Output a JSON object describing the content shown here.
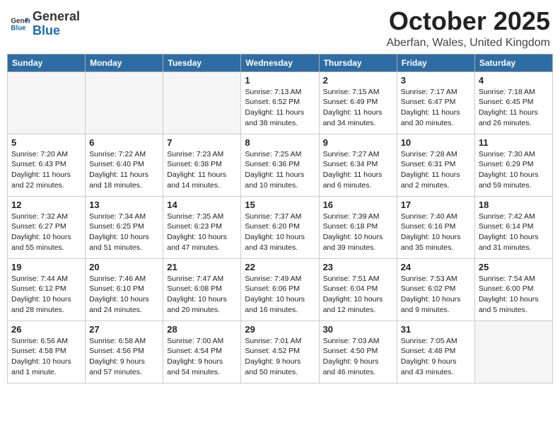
{
  "header": {
    "logo_general": "General",
    "logo_blue": "Blue",
    "month_title": "October 2025",
    "location": "Aberfan, Wales, United Kingdom"
  },
  "weekdays": [
    "Sunday",
    "Monday",
    "Tuesday",
    "Wednesday",
    "Thursday",
    "Friday",
    "Saturday"
  ],
  "weeks": [
    [
      {
        "day": "",
        "text": ""
      },
      {
        "day": "",
        "text": ""
      },
      {
        "day": "",
        "text": ""
      },
      {
        "day": "1",
        "text": "Sunrise: 7:13 AM\nSunset: 6:52 PM\nDaylight: 11 hours\nand 38 minutes."
      },
      {
        "day": "2",
        "text": "Sunrise: 7:15 AM\nSunset: 6:49 PM\nDaylight: 11 hours\nand 34 minutes."
      },
      {
        "day": "3",
        "text": "Sunrise: 7:17 AM\nSunset: 6:47 PM\nDaylight: 11 hours\nand 30 minutes."
      },
      {
        "day": "4",
        "text": "Sunrise: 7:18 AM\nSunset: 6:45 PM\nDaylight: 11 hours\nand 26 minutes."
      }
    ],
    [
      {
        "day": "5",
        "text": "Sunrise: 7:20 AM\nSunset: 6:43 PM\nDaylight: 11 hours\nand 22 minutes."
      },
      {
        "day": "6",
        "text": "Sunrise: 7:22 AM\nSunset: 6:40 PM\nDaylight: 11 hours\nand 18 minutes."
      },
      {
        "day": "7",
        "text": "Sunrise: 7:23 AM\nSunset: 6:38 PM\nDaylight: 11 hours\nand 14 minutes."
      },
      {
        "day": "8",
        "text": "Sunrise: 7:25 AM\nSunset: 6:36 PM\nDaylight: 11 hours\nand 10 minutes."
      },
      {
        "day": "9",
        "text": "Sunrise: 7:27 AM\nSunset: 6:34 PM\nDaylight: 11 hours\nand 6 minutes."
      },
      {
        "day": "10",
        "text": "Sunrise: 7:28 AM\nSunset: 6:31 PM\nDaylight: 11 hours\nand 2 minutes."
      },
      {
        "day": "11",
        "text": "Sunrise: 7:30 AM\nSunset: 6:29 PM\nDaylight: 10 hours\nand 59 minutes."
      }
    ],
    [
      {
        "day": "12",
        "text": "Sunrise: 7:32 AM\nSunset: 6:27 PM\nDaylight: 10 hours\nand 55 minutes."
      },
      {
        "day": "13",
        "text": "Sunrise: 7:34 AM\nSunset: 6:25 PM\nDaylight: 10 hours\nand 51 minutes."
      },
      {
        "day": "14",
        "text": "Sunrise: 7:35 AM\nSunset: 6:23 PM\nDaylight: 10 hours\nand 47 minutes."
      },
      {
        "day": "15",
        "text": "Sunrise: 7:37 AM\nSunset: 6:20 PM\nDaylight: 10 hours\nand 43 minutes."
      },
      {
        "day": "16",
        "text": "Sunrise: 7:39 AM\nSunset: 6:18 PM\nDaylight: 10 hours\nand 39 minutes."
      },
      {
        "day": "17",
        "text": "Sunrise: 7:40 AM\nSunset: 6:16 PM\nDaylight: 10 hours\nand 35 minutes."
      },
      {
        "day": "18",
        "text": "Sunrise: 7:42 AM\nSunset: 6:14 PM\nDaylight: 10 hours\nand 31 minutes."
      }
    ],
    [
      {
        "day": "19",
        "text": "Sunrise: 7:44 AM\nSunset: 6:12 PM\nDaylight: 10 hours\nand 28 minutes."
      },
      {
        "day": "20",
        "text": "Sunrise: 7:46 AM\nSunset: 6:10 PM\nDaylight: 10 hours\nand 24 minutes."
      },
      {
        "day": "21",
        "text": "Sunrise: 7:47 AM\nSunset: 6:08 PM\nDaylight: 10 hours\nand 20 minutes."
      },
      {
        "day": "22",
        "text": "Sunrise: 7:49 AM\nSunset: 6:06 PM\nDaylight: 10 hours\nand 16 minutes."
      },
      {
        "day": "23",
        "text": "Sunrise: 7:51 AM\nSunset: 6:04 PM\nDaylight: 10 hours\nand 12 minutes."
      },
      {
        "day": "24",
        "text": "Sunrise: 7:53 AM\nSunset: 6:02 PM\nDaylight: 10 hours\nand 9 minutes."
      },
      {
        "day": "25",
        "text": "Sunrise: 7:54 AM\nSunset: 6:00 PM\nDaylight: 10 hours\nand 5 minutes."
      }
    ],
    [
      {
        "day": "26",
        "text": "Sunrise: 6:56 AM\nSunset: 4:58 PM\nDaylight: 10 hours\nand 1 minute."
      },
      {
        "day": "27",
        "text": "Sunrise: 6:58 AM\nSunset: 4:56 PM\nDaylight: 9 hours\nand 57 minutes."
      },
      {
        "day": "28",
        "text": "Sunrise: 7:00 AM\nSunset: 4:54 PM\nDaylight: 9 hours\nand 54 minutes."
      },
      {
        "day": "29",
        "text": "Sunrise: 7:01 AM\nSunset: 4:52 PM\nDaylight: 9 hours\nand 50 minutes."
      },
      {
        "day": "30",
        "text": "Sunrise: 7:03 AM\nSunset: 4:50 PM\nDaylight: 9 hours\nand 46 minutes."
      },
      {
        "day": "31",
        "text": "Sunrise: 7:05 AM\nSunset: 4:48 PM\nDaylight: 9 hours\nand 43 minutes."
      },
      {
        "day": "",
        "text": ""
      }
    ]
  ]
}
